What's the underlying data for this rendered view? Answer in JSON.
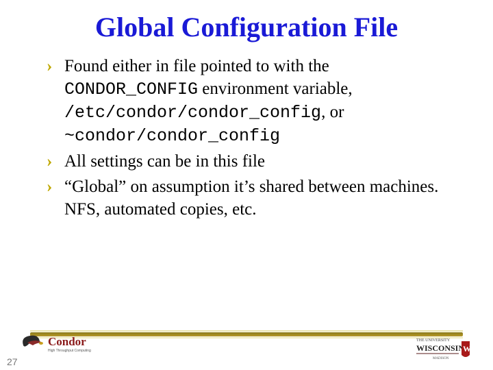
{
  "title": "Global Configuration File",
  "bullets": [
    {
      "parts": [
        {
          "text": "Found either in file pointed to with the ",
          "mono": false
        },
        {
          "text": "CONDOR_CONFIG",
          "mono": true
        },
        {
          "text": " environment variable, ",
          "mono": false
        },
        {
          "text": "/etc/condor/condor_config",
          "mono": true
        },
        {
          "text": ", or ",
          "mono": false
        },
        {
          "text": "~condor/condor_config",
          "mono": true
        }
      ]
    },
    {
      "parts": [
        {
          "text": "All settings can be in this file",
          "mono": false
        }
      ]
    },
    {
      "parts": [
        {
          "text": "“Global” on assumption it’s shared between machines. NFS, automated copies, etc.",
          "mono": false
        }
      ]
    }
  ],
  "slide_number": "27",
  "logos": {
    "condor": "Condor",
    "wisconsin_top": "THE UNIVERSITY",
    "wisconsin_bottom": "WISCONSIN"
  }
}
